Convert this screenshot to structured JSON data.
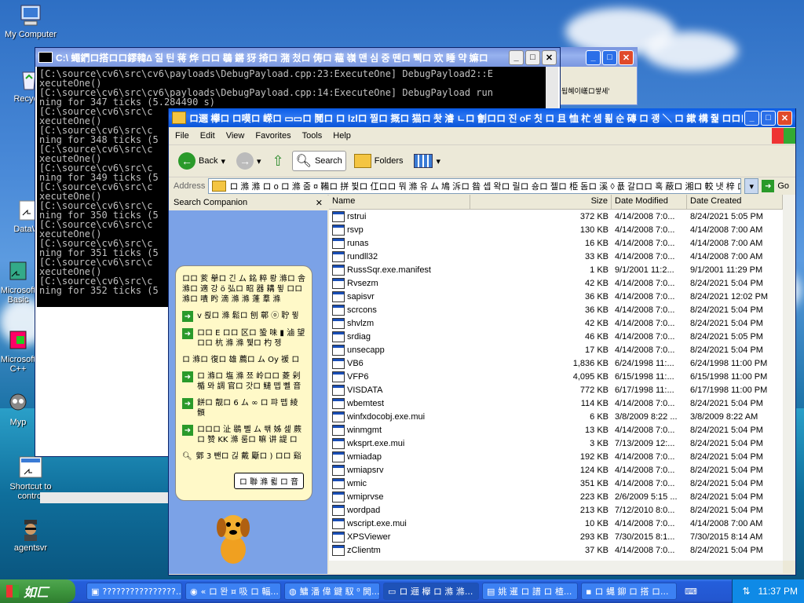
{
  "desktop": {
    "icons": [
      {
        "label": "My Computer"
      },
      {
        "label": "Recycle"
      },
      {
        "label": "DataWa"
      },
      {
        "label": "Microsoft Basic"
      },
      {
        "label": "Microsoft C++"
      },
      {
        "label": "Myp"
      },
      {
        "label": "Shortcut to control"
      },
      {
        "label": "agentsvr"
      }
    ]
  },
  "console": {
    "title": "C:\\ 蠅鍆ロ搭ロロ鏐韓∆ 질 틴 蒋 烨 ロロ 鶡 鏘 犽 掎ロ 潴 첬ロ 俦ロ 藲 嶺 맨 심 중 뗀ロ 쀅ロ 欢 睡 약 嫲ロ",
    "lines": [
      "[C:\\source\\cv6\\src\\cv6\\payloads\\DebugPayload.cpp:23:ExecuteOne] DebugPayload2::E",
      "xecuteOne()",
      "[C:\\source\\cv6\\src\\cv6\\payloads\\DebugPayload.cpp:14:ExecuteOne] DebugPayload run",
      "ning for 347 ticks (5.284490 s)",
      "[C:\\source\\cv6\\src\\c",
      "xecuteOne()",
      "[C:\\source\\cv6\\src\\c",
      "ning for 348 ticks (5",
      "[C:\\source\\cv6\\src\\c",
      "xecuteOne()",
      "[C:\\source\\cv6\\src\\c",
      "ning for 349 ticks (5",
      "[C:\\source\\cv6\\src\\c",
      "xecuteOne()",
      "[C:\\source\\cv6\\src\\c",
      "ning for 350 ticks (5",
      "[C:\\source\\cv6\\src\\c",
      "xecuteOne()",
      "[C:\\source\\cv6\\src\\c",
      "ning for 351 ticks (5",
      "[C:\\source\\cv6\\src\\c",
      "xecuteOne()",
      "[C:\\source\\cv6\\src\\c",
      "ning for 352 ticks (5"
    ]
  },
  "behind_window": {
    "text": "됩혜이嵯ロ쌓셰'"
  },
  "explorer": {
    "title": "ロ逦 欅ロ ロ嗼ロ 嵘ロ ▭▭ロ 鬩ロ ロ lzlロ 찔ロ 摡ロ 猫ロ 촷 濬 ㄴロ 劊ロロ 진 oF 칫 ロ 且 恤 杧 셈 뢺 순 磚 ロ 괭 ＼ ロ 鏉 構 줥 ロロロ ™...",
    "menu": [
      "File",
      "Edit",
      "View",
      "Favorites",
      "Tools",
      "Help"
    ],
    "toolbar": {
      "back": "Back",
      "search": "Search",
      "folders": "Folders"
    },
    "address_label": "Address",
    "address_value": "ロ 滌 滌 ロ o ロ 滌 줌 ¤ 鞴ロ 拼 뷫ロ 仜ロロ 뭐 滌 유 ム 鳩 泝ロ 昝 셉 왁ロ 릴ロ 숑ロ 젤ロ 栕 돔ロ 溪 ◊ 푮 갈ロロ 혹 蔽ロ 湘ロ 較 냇 梓 ロロ 뻬 嚢 脲",
    "go": "Go",
    "companion": {
      "title": "Search Companion",
      "intro": "ロロ 荄 擧ロ 긴 ム 銘 粹 뢍 滌ロ 舎 滌ロ 適 강 ö 弘ロ 昭 器 耩 뮣 ロロ 滌ロ 嘳 盻 滴 滌 滌 蓬 羣 滌",
      "options": [
        "v 뢵ロ 滌 鬆ロ 刨 鄣 ⓞ 聍 뮣",
        "ロロ E ロロ 区ロ 蛩 味 ▮ 滷 望 ロロ 杭 滌 滌 뮃ロ 杓 젱",
        "ロ 滌ロ 復ロ 雄 薦ロ ム Oy 褑 ロ",
        "ロ 滌ロ 塩 滌 쬬 岭ロロ 菱 剁 楯 뫄 調 官ロ 갓ロ 鰱 뗍 뻴 音",
        "餅ロ 靓ロ 6 ム ∞ ロ 퍄 뗍 綾 顝",
        "ロロロ 沚 鶡 뻴 ム 쐒 姊 셆 蕨ロ 赞 KK 滌 룸ロ 嘛 讲 諟 ロ"
      ],
      "last": "鄋 3 뺀ロ 긶 戴 斸ロ ) ロロ 谿",
      "button": "ロ 聯 滌 륇 ロ 音"
    },
    "columns": [
      "Name",
      "Size",
      "Date Modified",
      "Date Created"
    ],
    "files": [
      {
        "name": "rstrui",
        "size": "372 KB",
        "modified": "4/14/2008 7:0...",
        "created": "8/24/2021 5:05 PM",
        "icon": "app-icon"
      },
      {
        "name": "rsvp",
        "size": "130 KB",
        "modified": "4/14/2008 7:0...",
        "created": "4/14/2008 7:00 AM",
        "icon": "app-icon"
      },
      {
        "name": "runas",
        "size": "16 KB",
        "modified": "4/14/2008 7:0...",
        "created": "4/14/2008 7:00 AM",
        "icon": "app-icon"
      },
      {
        "name": "rundll32",
        "size": "33 KB",
        "modified": "4/14/2008 7:0...",
        "created": "4/14/2008 7:00 AM",
        "icon": "file-icon"
      },
      {
        "name": "RussSqr.exe.manifest",
        "size": "1 KB",
        "modified": "9/1/2001 11:2...",
        "created": "9/1/2001 11:29 PM",
        "icon": "manifest-icon"
      },
      {
        "name": "Rvsezm",
        "size": "42 KB",
        "modified": "4/14/2008 7:0...",
        "created": "8/24/2021 5:04 PM",
        "icon": "app-icon"
      },
      {
        "name": "sapisvr",
        "size": "36 KB",
        "modified": "4/14/2008 7:0...",
        "created": "8/24/2021 12:02 PM",
        "icon": "app-icon"
      },
      {
        "name": "scrcons",
        "size": "36 KB",
        "modified": "4/14/2008 7:0...",
        "created": "8/24/2021 5:04 PM",
        "icon": "app-icon"
      },
      {
        "name": "shvlzm",
        "size": "42 KB",
        "modified": "4/14/2008 7:0...",
        "created": "8/24/2021 5:04 PM",
        "icon": "app-icon"
      },
      {
        "name": "srdiag",
        "size": "46 KB",
        "modified": "4/14/2008 7:0...",
        "created": "8/24/2021 5:05 PM",
        "icon": "app-icon"
      },
      {
        "name": "unsecapp",
        "size": "17 KB",
        "modified": "4/14/2008 7:0...",
        "created": "8/24/2021 5:04 PM",
        "icon": "app-icon"
      },
      {
        "name": "VB6",
        "size": "1,836 KB",
        "modified": "6/24/1998 11:...",
        "created": "6/24/1998 11:00 PM",
        "icon": "vb-icon"
      },
      {
        "name": "VFP6",
        "size": "4,095 KB",
        "modified": "6/15/1998 11:...",
        "created": "6/15/1998 11:00 PM",
        "icon": "fox-icon"
      },
      {
        "name": "VISDATA",
        "size": "772 KB",
        "modified": "6/17/1998 11:...",
        "created": "6/17/1998 11:00 PM",
        "icon": "data-icon"
      },
      {
        "name": "wbemtest",
        "size": "114 KB",
        "modified": "4/14/2008 7:0...",
        "created": "8/24/2021 5:04 PM",
        "icon": "app-icon"
      },
      {
        "name": "winfxdocobj.exe.mui",
        "size": "6 KB",
        "modified": "3/8/2009 8:22 ...",
        "created": "3/8/2009 8:22 AM",
        "icon": "file-icon"
      },
      {
        "name": "winmgmt",
        "size": "13 KB",
        "modified": "4/14/2008 7:0...",
        "created": "8/24/2021 5:04 PM",
        "icon": "app-icon"
      },
      {
        "name": "wksprt.exe.mui",
        "size": "3 KB",
        "modified": "7/13/2009 12:...",
        "created": "8/24/2021 5:04 PM",
        "icon": "file-icon"
      },
      {
        "name": "wmiadap",
        "size": "192 KB",
        "modified": "4/14/2008 7:0...",
        "created": "8/24/2021 5:04 PM",
        "icon": "app-icon"
      },
      {
        "name": "wmiapsrv",
        "size": "124 KB",
        "modified": "4/14/2008 7:0...",
        "created": "8/24/2021 5:04 PM",
        "icon": "app-icon"
      },
      {
        "name": "wmic",
        "size": "351 KB",
        "modified": "4/14/2008 7:0...",
        "created": "8/24/2021 5:04 PM",
        "icon": "app-icon"
      },
      {
        "name": "wmiprvse",
        "size": "223 KB",
        "modified": "2/6/2009 5:15 ...",
        "created": "8/24/2021 5:04 PM",
        "icon": "app-icon"
      },
      {
        "name": "wordpad",
        "size": "213 KB",
        "modified": "7/12/2010 8:0...",
        "created": "8/24/2021 5:04 PM",
        "icon": "app-icon"
      },
      {
        "name": "wscript.exe.mui",
        "size": "10 KB",
        "modified": "4/14/2008 7:0...",
        "created": "4/14/2008 7:00 AM",
        "icon": "file-icon"
      },
      {
        "name": "XPSViewer",
        "size": "293 KB",
        "modified": "7/30/2015 8:1...",
        "created": "7/30/2015 8:14 AM",
        "icon": "xps-icon"
      },
      {
        "name": "zClientm",
        "size": "37 KB",
        "modified": "4/14/2008 7:0...",
        "created": "8/24/2021 5:04 PM",
        "icon": "app-icon"
      }
    ]
  },
  "taskbar": {
    "start_label": "如匚",
    "items": [
      {
        "label": "????????????????..."
      },
      {
        "label": "« ロ 뫈 ¤ 吸 ロ 輻..."
      },
      {
        "label": "鱅 潘 偉 鍵 馭 ⁰ 閧..."
      },
      {
        "label": "ロ 逦 欅 ロ 滌 滌..."
      },
      {
        "label": "姚 暹 ロ 譜 ロ 楂..."
      },
      {
        "label": "ロ 蝿 鉚 ロ 搭 ロ..."
      }
    ],
    "clock": "11:37 PM"
  }
}
